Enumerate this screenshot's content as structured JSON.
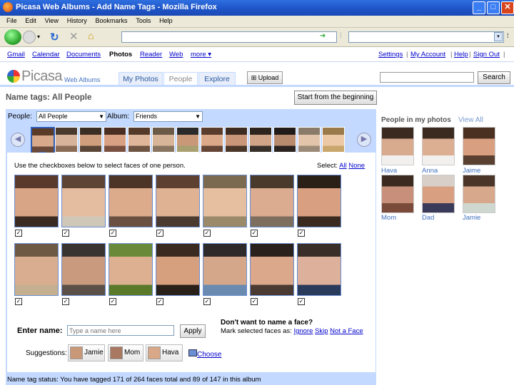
{
  "window": {
    "title": "Picasa Web Albums - Add Name Tags - Mozilla Firefox",
    "controls": [
      "_",
      "□",
      "✕"
    ]
  },
  "menu": [
    "File",
    "Edit",
    "View",
    "History",
    "Bookmarks",
    "Tools",
    "Help"
  ],
  "google_bar": {
    "left": [
      "Gmail",
      "Calendar",
      "Documents",
      "Photos",
      "Reader",
      "Web",
      "more ▾"
    ],
    "right": [
      "Settings",
      "|",
      "My Account",
      "|",
      "Help",
      "|",
      "Sign Out",
      "|"
    ]
  },
  "picasa": {
    "logo": "Picasa",
    "logo_sub": "Web Albums",
    "tabs": [
      "My Photos",
      "People",
      "Explore"
    ],
    "active_tab": "People",
    "upload_label": "Upload",
    "search_label": "Search"
  },
  "page": {
    "title": "Name tags: All People",
    "start_over": "Start from the beginning",
    "people_label": "People:",
    "people_value": "All People",
    "album_label": "Album:",
    "album_value": "Friends",
    "instruction": "Use the checkboxes below to select faces of one person.",
    "select_label": "Select:",
    "select_all": "All",
    "select_none": "None",
    "check_mark": "✓"
  },
  "naming": {
    "enter_label": "Enter name:",
    "placeholder": "Type a name here",
    "apply": "Apply",
    "dont_want": "Don't want to name a face?",
    "mark_selected": "Mark selected faces as:",
    "ignore": "Ignore",
    "skip": "Skip",
    "not_a_face": "Not a Face",
    "suggestions_label": "Suggestions:",
    "suggestions": [
      "Jamie",
      "Mom",
      "Hava"
    ],
    "choose": "Choose"
  },
  "status": "Name tag status:  You have tagged 171 of 264 faces total and 89 of 147 in this album",
  "sidebar": {
    "title": "People in my photos",
    "view_all": "View All",
    "people": [
      "Hava",
      "Anna",
      "Jaime",
      "Mom",
      "Dad",
      "Jamie"
    ]
  },
  "colors": {
    "accent": "#c3d9ff",
    "link": "#0000cc",
    "title_bar": "#2f6fe0"
  }
}
